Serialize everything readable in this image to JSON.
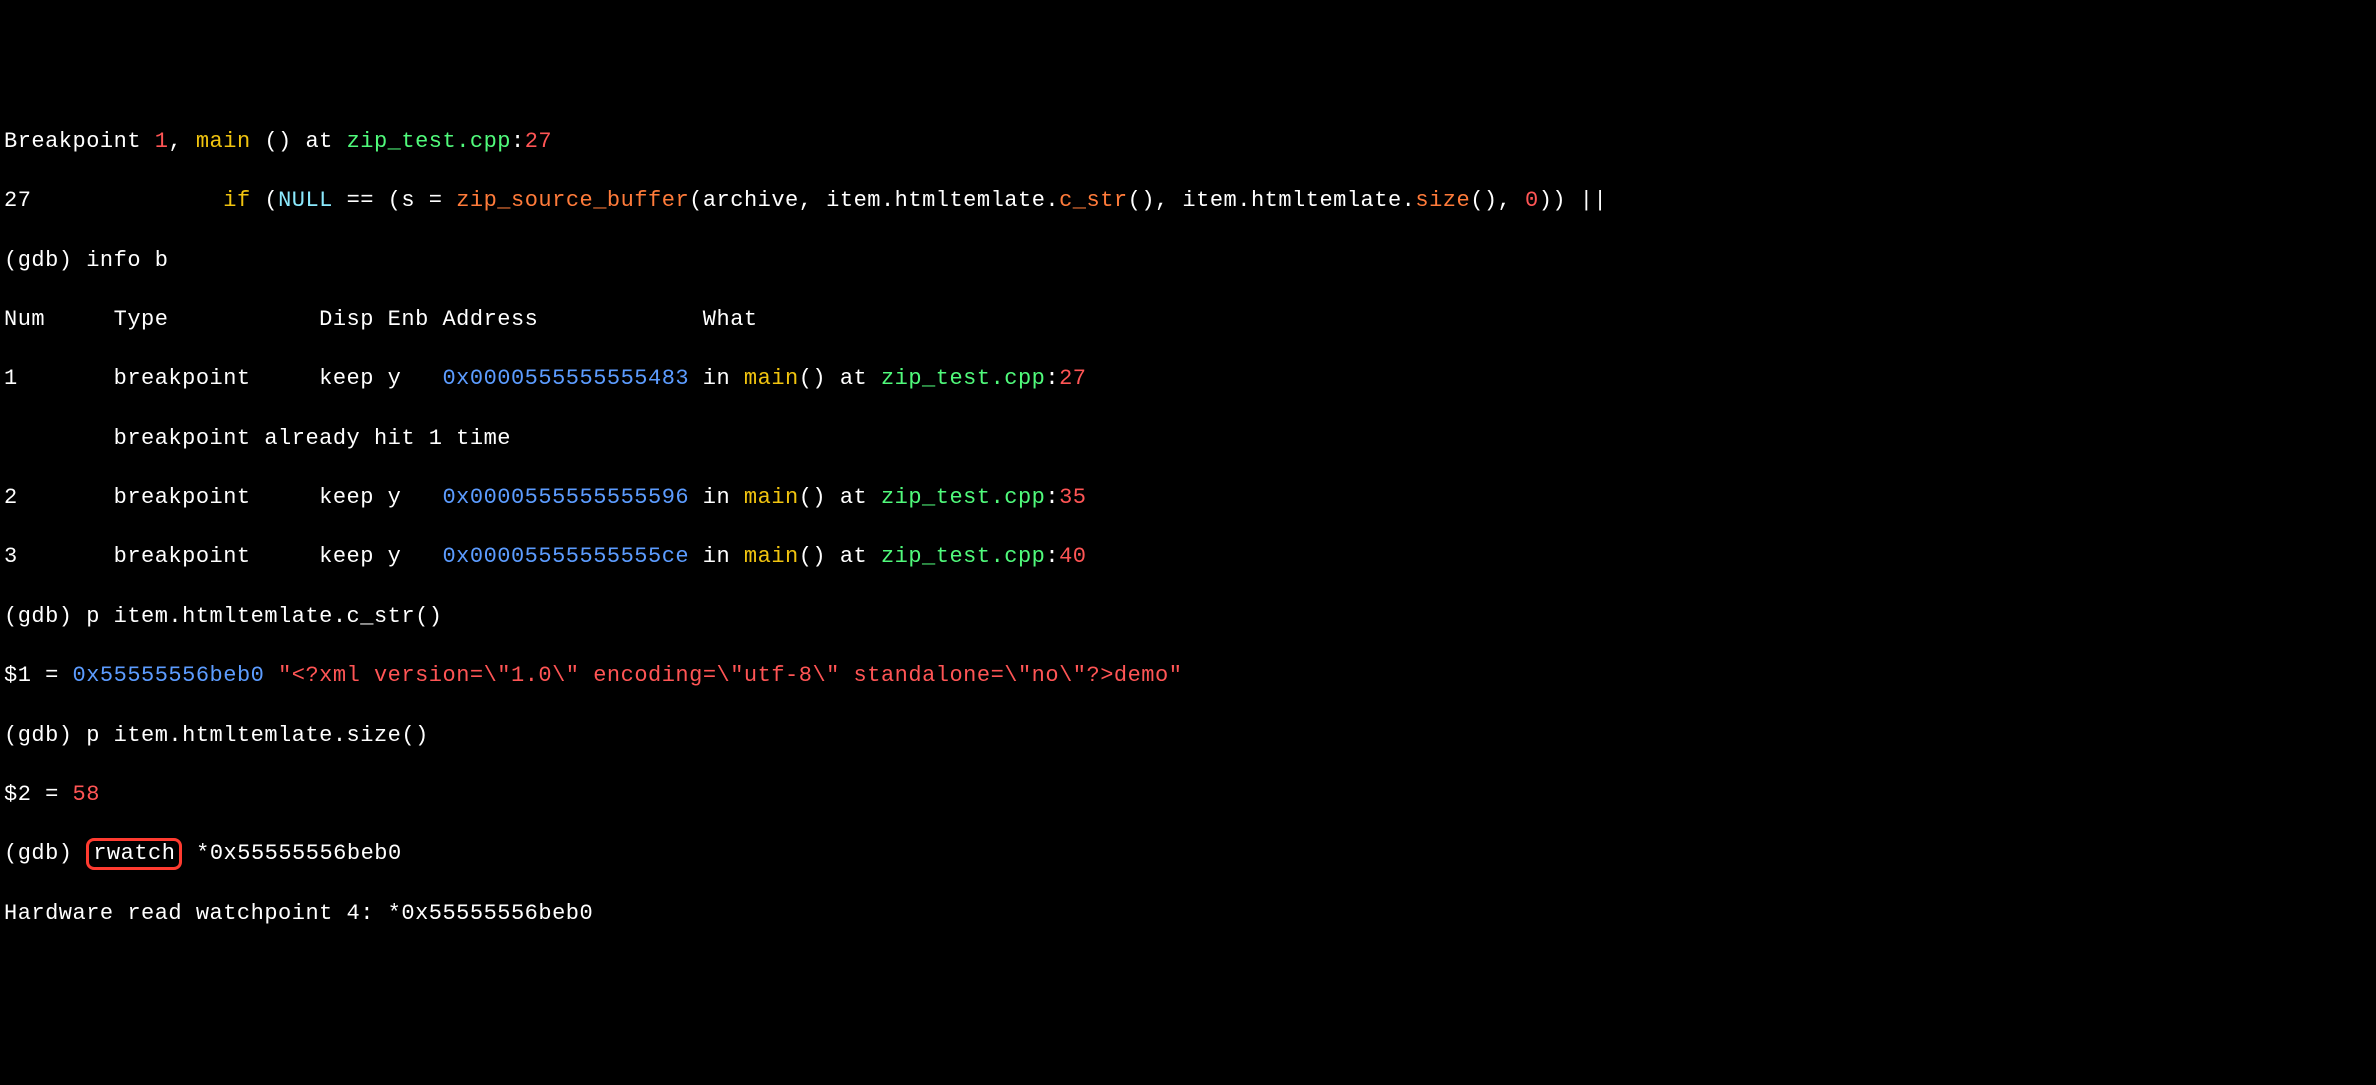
{
  "lines": {
    "l1_a": "Breakpoint ",
    "l1_b": "1",
    "l1_c": ", ",
    "l1_d": "main",
    "l1_e": " () at ",
    "l1_f": "zip_test.cpp",
    "l1_g": ":",
    "l1_h": "27",
    "l2_a": "27",
    "l2_b": "              ",
    "l2_c": "if",
    "l2_d": " (",
    "l2_e": "NULL",
    "l2_f": " == (s = ",
    "l2_g": "zip_source_buffer",
    "l2_h": "(archive, item.htmltemlate.",
    "l2_i": "c_str",
    "l2_j": "(), item.htmltemlate.",
    "l2_k": "size",
    "l2_l": "(), ",
    "l2_m": "0",
    "l2_n": ")) ||",
    "l3": "(gdb) info b",
    "l4": "Num     Type           Disp Enb Address            What",
    "l5_a": "1       breakpoint     keep y   ",
    "l5_b": "0x0000555555555483",
    "l5_c": " in ",
    "l5_d": "main",
    "l5_e": "() at ",
    "l5_f": "zip_test.cpp",
    "l5_g": ":",
    "l5_h": "27",
    "l6": "        breakpoint already hit 1 time",
    "l7_a": "2       breakpoint     keep y   ",
    "l7_b": "0x0000555555555596",
    "l7_c": " in ",
    "l7_d": "main",
    "l7_e": "() at ",
    "l7_f": "zip_test.cpp",
    "l7_g": ":",
    "l7_h": "35",
    "l8_a": "3       breakpoint     keep y   ",
    "l8_b": "0x00005555555555ce",
    "l8_c": " in ",
    "l8_d": "main",
    "l8_e": "() at ",
    "l8_f": "zip_test.cpp",
    "l8_g": ":",
    "l8_h": "40",
    "l9": "(gdb) p item.htmltemlate.c_str()",
    "l10_a": "$1 = ",
    "l10_b": "0x55555556beb0",
    "l10_c": " ",
    "l10_d": "\"<?xml version=\\\"1.0\\\" encoding=\\\"utf-8\\\" standalone=\\\"no\\\"?>demo\"",
    "l11": "(gdb) p item.htmltemlate.size()",
    "l12_a": "$2 = ",
    "l12_b": "58",
    "l13_a": "(gdb) ",
    "l13_b": "rwatch",
    "l13_c": " *0x55555556beb0",
    "l14": "Hardware read watchpoint 4: *0x55555556beb0"
  }
}
